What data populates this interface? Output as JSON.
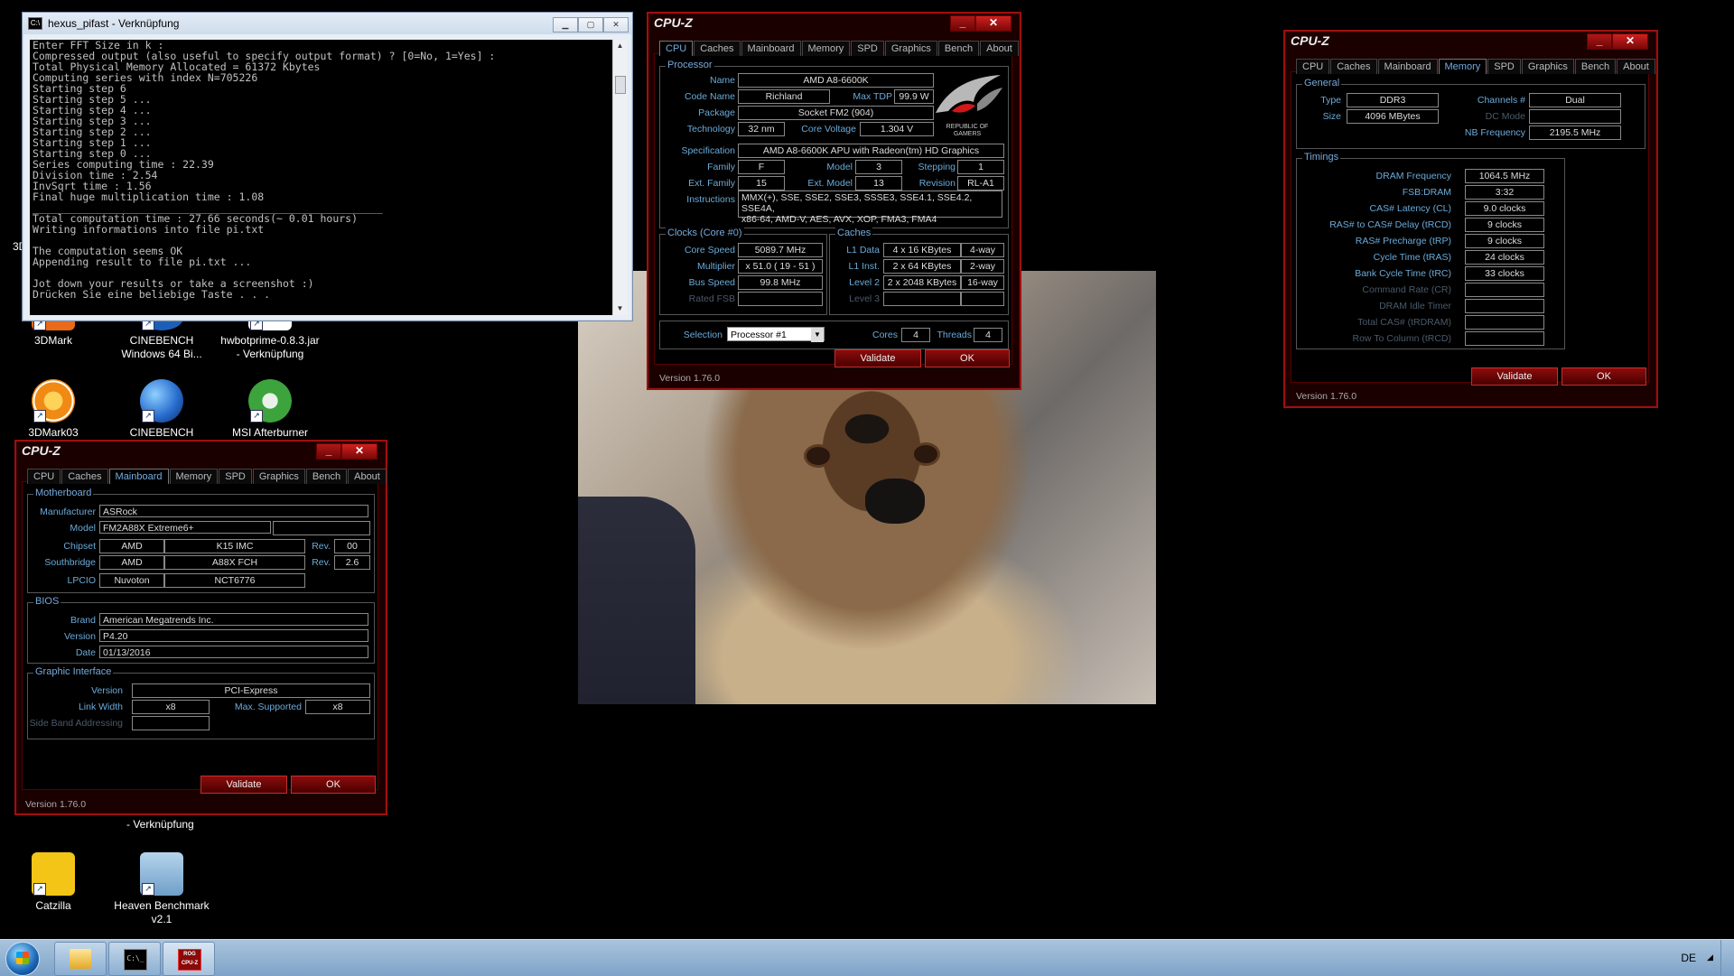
{
  "desktop": {
    "icons": [
      {
        "label": "3DMark",
        "color": "#e86a1a"
      },
      {
        "label": "CINEBENCH\nWindows 64 Bi...",
        "color": "#1d5fb8"
      },
      {
        "label": "hwbotprime-0.8.3.jar\n- Verknüpfung",
        "color": "#ffffff"
      },
      {
        "label": "3DMark03",
        "color": "#f08a14"
      },
      {
        "label": "CINEBENCH",
        "color": "#2a6fd0"
      },
      {
        "label": "MSI Afterburner",
        "color": "#3da33d"
      },
      {
        "label": "Catzilla",
        "color": "#f3c516"
      },
      {
        "label": "Heaven Benchmark\nv2.1",
        "color": "#7fb0d8"
      }
    ],
    "partial_label_left": "3D",
    "partial_label_below": "- Verknüpfung"
  },
  "console": {
    "title": "hexus_pifast - Verknüpfung",
    "lines": "Enter FFT Size in k :\nCompressed output (also useful to specify output format) ? [0=No, 1=Yes] :\nTotal Physical Memory Allocated = 61372 Kbytes\nComputing series with index N=705226\nStarting step 6\nStarting step 5 ...\nStarting step 4 ...\nStarting step 3 ...\nStarting step 2 ...\nStarting step 1 ...\nStarting step 0 ...\nSeries computing time : 22.39\nDivision time : 2.54\nInvSqrt time : 1.56\nFinal huge multiplication time : 1.08\n________________________________________________________\nTotal computation time : 27.66 seconds(~ 0.01 hours)\nWriting informations into file pi.txt\n\nThe computation seems OK\nAppending result to file pi.txt ...\n\nJot down your results or take a screenshot :)\nDrücken Sie eine beliebige Taste . . ."
  },
  "cpuz_common": {
    "title": "CPU-Z",
    "min": "_",
    "close": "✕",
    "tabs": [
      "CPU",
      "Caches",
      "Mainboard",
      "Memory",
      "SPD",
      "Graphics",
      "Bench",
      "About"
    ],
    "validate": "Validate",
    "ok": "OK",
    "version": "Version 1.76.0"
  },
  "cpu": {
    "processor_group": "Processor",
    "name_label": "Name",
    "name": "AMD A8-6600K",
    "codename_label": "Code Name",
    "codename": "Richland",
    "maxtdp_label": "Max TDP",
    "maxtdp": "99.9 W",
    "package_label": "Package",
    "package": "Socket FM2 (904)",
    "technology_label": "Technology",
    "technology": "32 nm",
    "corevoltage_label": "Core Voltage",
    "corevoltage": "1.304 V",
    "spec_label": "Specification",
    "spec": "AMD A8-6600K APU with Radeon(tm) HD Graphics",
    "family_label": "Family",
    "family": "F",
    "model_label": "Model",
    "model": "3",
    "stepping_label": "Stepping",
    "stepping": "1",
    "extfamily_label": "Ext. Family",
    "extfamily": "15",
    "extmodel_label": "Ext. Model",
    "extmodel": "13",
    "revision_label": "Revision",
    "revision": "RL-A1",
    "instructions_label": "Instructions",
    "instructions": "MMX(+), SSE, SSE2, SSE3, SSSE3, SSE4.1, SSE4.2, SSE4A,\nx86-64, AMD-V, AES, AVX, XOP, FMA3, FMA4",
    "clocks_group": "Clocks (Core #0)",
    "corespeed_label": "Core Speed",
    "corespeed": "5089.7 MHz",
    "multiplier_label": "Multiplier",
    "multiplier": "x 51.0 ( 19 - 51 )",
    "busspeed_label": "Bus Speed",
    "busspeed": "99.8 MHz",
    "ratedfsb_label": "Rated FSB",
    "ratedfsb": "",
    "caches_group": "Caches",
    "l1data_label": "L1 Data",
    "l1data": "4 x 16 KBytes",
    "l1data_way": "4-way",
    "l1inst_label": "L1 Inst.",
    "l1inst": "2 x 64 KBytes",
    "l1inst_way": "2-way",
    "level2_label": "Level 2",
    "level2": "2 x 2048 KBytes",
    "level2_way": "16-way",
    "level3_label": "Level 3",
    "level3": "",
    "level3_way": "",
    "selection_label": "Selection",
    "selection": "Processor #1",
    "cores_label": "Cores",
    "cores": "4",
    "threads_label": "Threads",
    "threads": "4",
    "logo_text": "REPUBLIC OF\nGAMERS"
  },
  "memory": {
    "general_group": "General",
    "type_label": "Type",
    "type": "DDR3",
    "channels_label": "Channels #",
    "channels": "Dual",
    "size_label": "Size",
    "size": "4096 MBytes",
    "dcmode_label": "DC Mode",
    "dcmode": "",
    "nbfreq_label": "NB Frequency",
    "nbfreq": "2195.5 MHz",
    "timings_group": "Timings",
    "timings": [
      {
        "label": "DRAM Frequency",
        "value": "1064.5 MHz",
        "dim": false
      },
      {
        "label": "FSB:DRAM",
        "value": "3:32",
        "dim": false
      },
      {
        "label": "CAS# Latency (CL)",
        "value": "9.0 clocks",
        "dim": false
      },
      {
        "label": "RAS# to CAS# Delay (tRCD)",
        "value": "9 clocks",
        "dim": false
      },
      {
        "label": "RAS# Precharge (tRP)",
        "value": "9 clocks",
        "dim": false
      },
      {
        "label": "Cycle Time (tRAS)",
        "value": "24 clocks",
        "dim": false
      },
      {
        "label": "Bank Cycle Time (tRC)",
        "value": "33 clocks",
        "dim": false
      },
      {
        "label": "Command Rate (CR)",
        "value": "",
        "dim": true
      },
      {
        "label": "DRAM Idle Timer",
        "value": "",
        "dim": true
      },
      {
        "label": "Total CAS# (tRDRAM)",
        "value": "",
        "dim": true
      },
      {
        "label": "Row To Column (tRCD)",
        "value": "",
        "dim": true
      }
    ]
  },
  "mainboard": {
    "mb_group": "Motherboard",
    "manufacturer_label": "Manufacturer",
    "manufacturer": "ASRock",
    "model_label": "Model",
    "model": "FM2A88X Extreme6+",
    "model_extra": "",
    "chipset_label": "Chipset",
    "chipset_vendor": "AMD",
    "chipset": "K15 IMC",
    "rev_label": "Rev.",
    "chipset_rev": "00",
    "southbridge_label": "Southbridge",
    "sb_vendor": "AMD",
    "southbridge": "A88X FCH",
    "sb_rev": "2.6",
    "lpcio_label": "LPCIO",
    "lpcio_vendor": "Nuvoton",
    "lpcio": "NCT6776",
    "bios_group": "BIOS",
    "brand_label": "Brand",
    "brand": "American Megatrends Inc.",
    "version_label": "Version",
    "bios_version": "P4.20",
    "date_label": "Date",
    "date": "01/13/2016",
    "gi_group": "Graphic Interface",
    "gi_version_label": "Version",
    "gi_version": "PCI-Express",
    "linkwidth_label": "Link Width",
    "linkwidth": "x8",
    "maxsup_label": "Max. Supported",
    "maxsup": "x8",
    "sideband_label": "Side Band Addressing",
    "sideband": ""
  },
  "taskbar": {
    "lang": "DE",
    "console_glyph": "C:\\_",
    "cpuz_glyph": "ROG CPU-Z"
  }
}
